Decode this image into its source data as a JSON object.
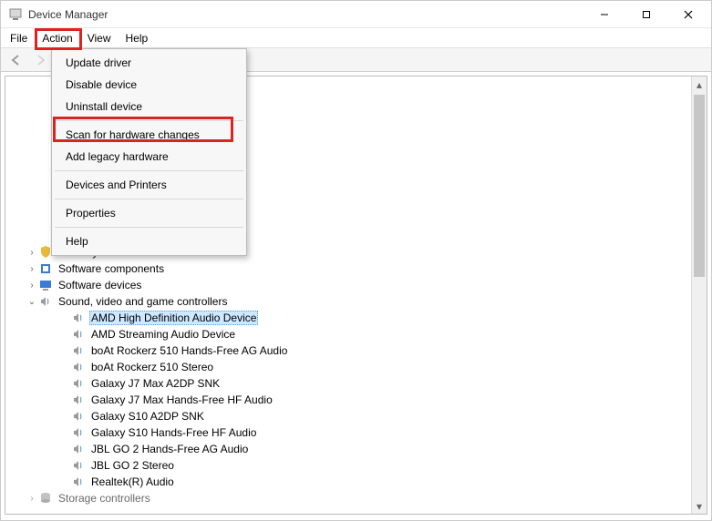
{
  "window": {
    "title": "Device Manager"
  },
  "menubar": {
    "items": [
      "File",
      "Action",
      "View",
      "Help"
    ],
    "activeIndex": 1
  },
  "dropdown": {
    "items": [
      {
        "label": "Update driver"
      },
      {
        "label": "Disable device"
      },
      {
        "label": "Uninstall device"
      },
      {
        "sep": true
      },
      {
        "label": "Scan for hardware changes",
        "highlighted": true
      },
      {
        "label": "Add legacy hardware"
      },
      {
        "sep": true
      },
      {
        "label": "Devices and Printers"
      },
      {
        "sep": true
      },
      {
        "label": "Properties"
      },
      {
        "sep": true
      },
      {
        "label": "Help"
      }
    ]
  },
  "tree": {
    "visible_categories": [
      {
        "label": "Security devices",
        "expanded": false,
        "icon": "security"
      },
      {
        "label": "Software components",
        "expanded": false,
        "icon": "component"
      },
      {
        "label": "Software devices",
        "expanded": false,
        "icon": "softdev"
      },
      {
        "label": "Sound, video and game controllers",
        "expanded": true,
        "icon": "sound",
        "children": [
          {
            "label": "AMD High Definition Audio Device",
            "selected": true
          },
          {
            "label": "AMD Streaming Audio Device"
          },
          {
            "label": "boAt Rockerz 510 Hands-Free AG Audio"
          },
          {
            "label": "boAt Rockerz 510 Stereo"
          },
          {
            "label": "Galaxy J7 Max A2DP SNK"
          },
          {
            "label": "Galaxy J7 Max Hands-Free HF Audio"
          },
          {
            "label": "Galaxy S10 A2DP SNK"
          },
          {
            "label": "Galaxy S10 Hands-Free HF Audio"
          },
          {
            "label": "JBL GO 2 Hands-Free AG Audio"
          },
          {
            "label": "JBL GO 2 Stereo"
          },
          {
            "label": "Realtek(R) Audio"
          }
        ]
      },
      {
        "label": "Storage controllers",
        "expanded": false,
        "icon": "storage",
        "partial": true
      }
    ]
  }
}
